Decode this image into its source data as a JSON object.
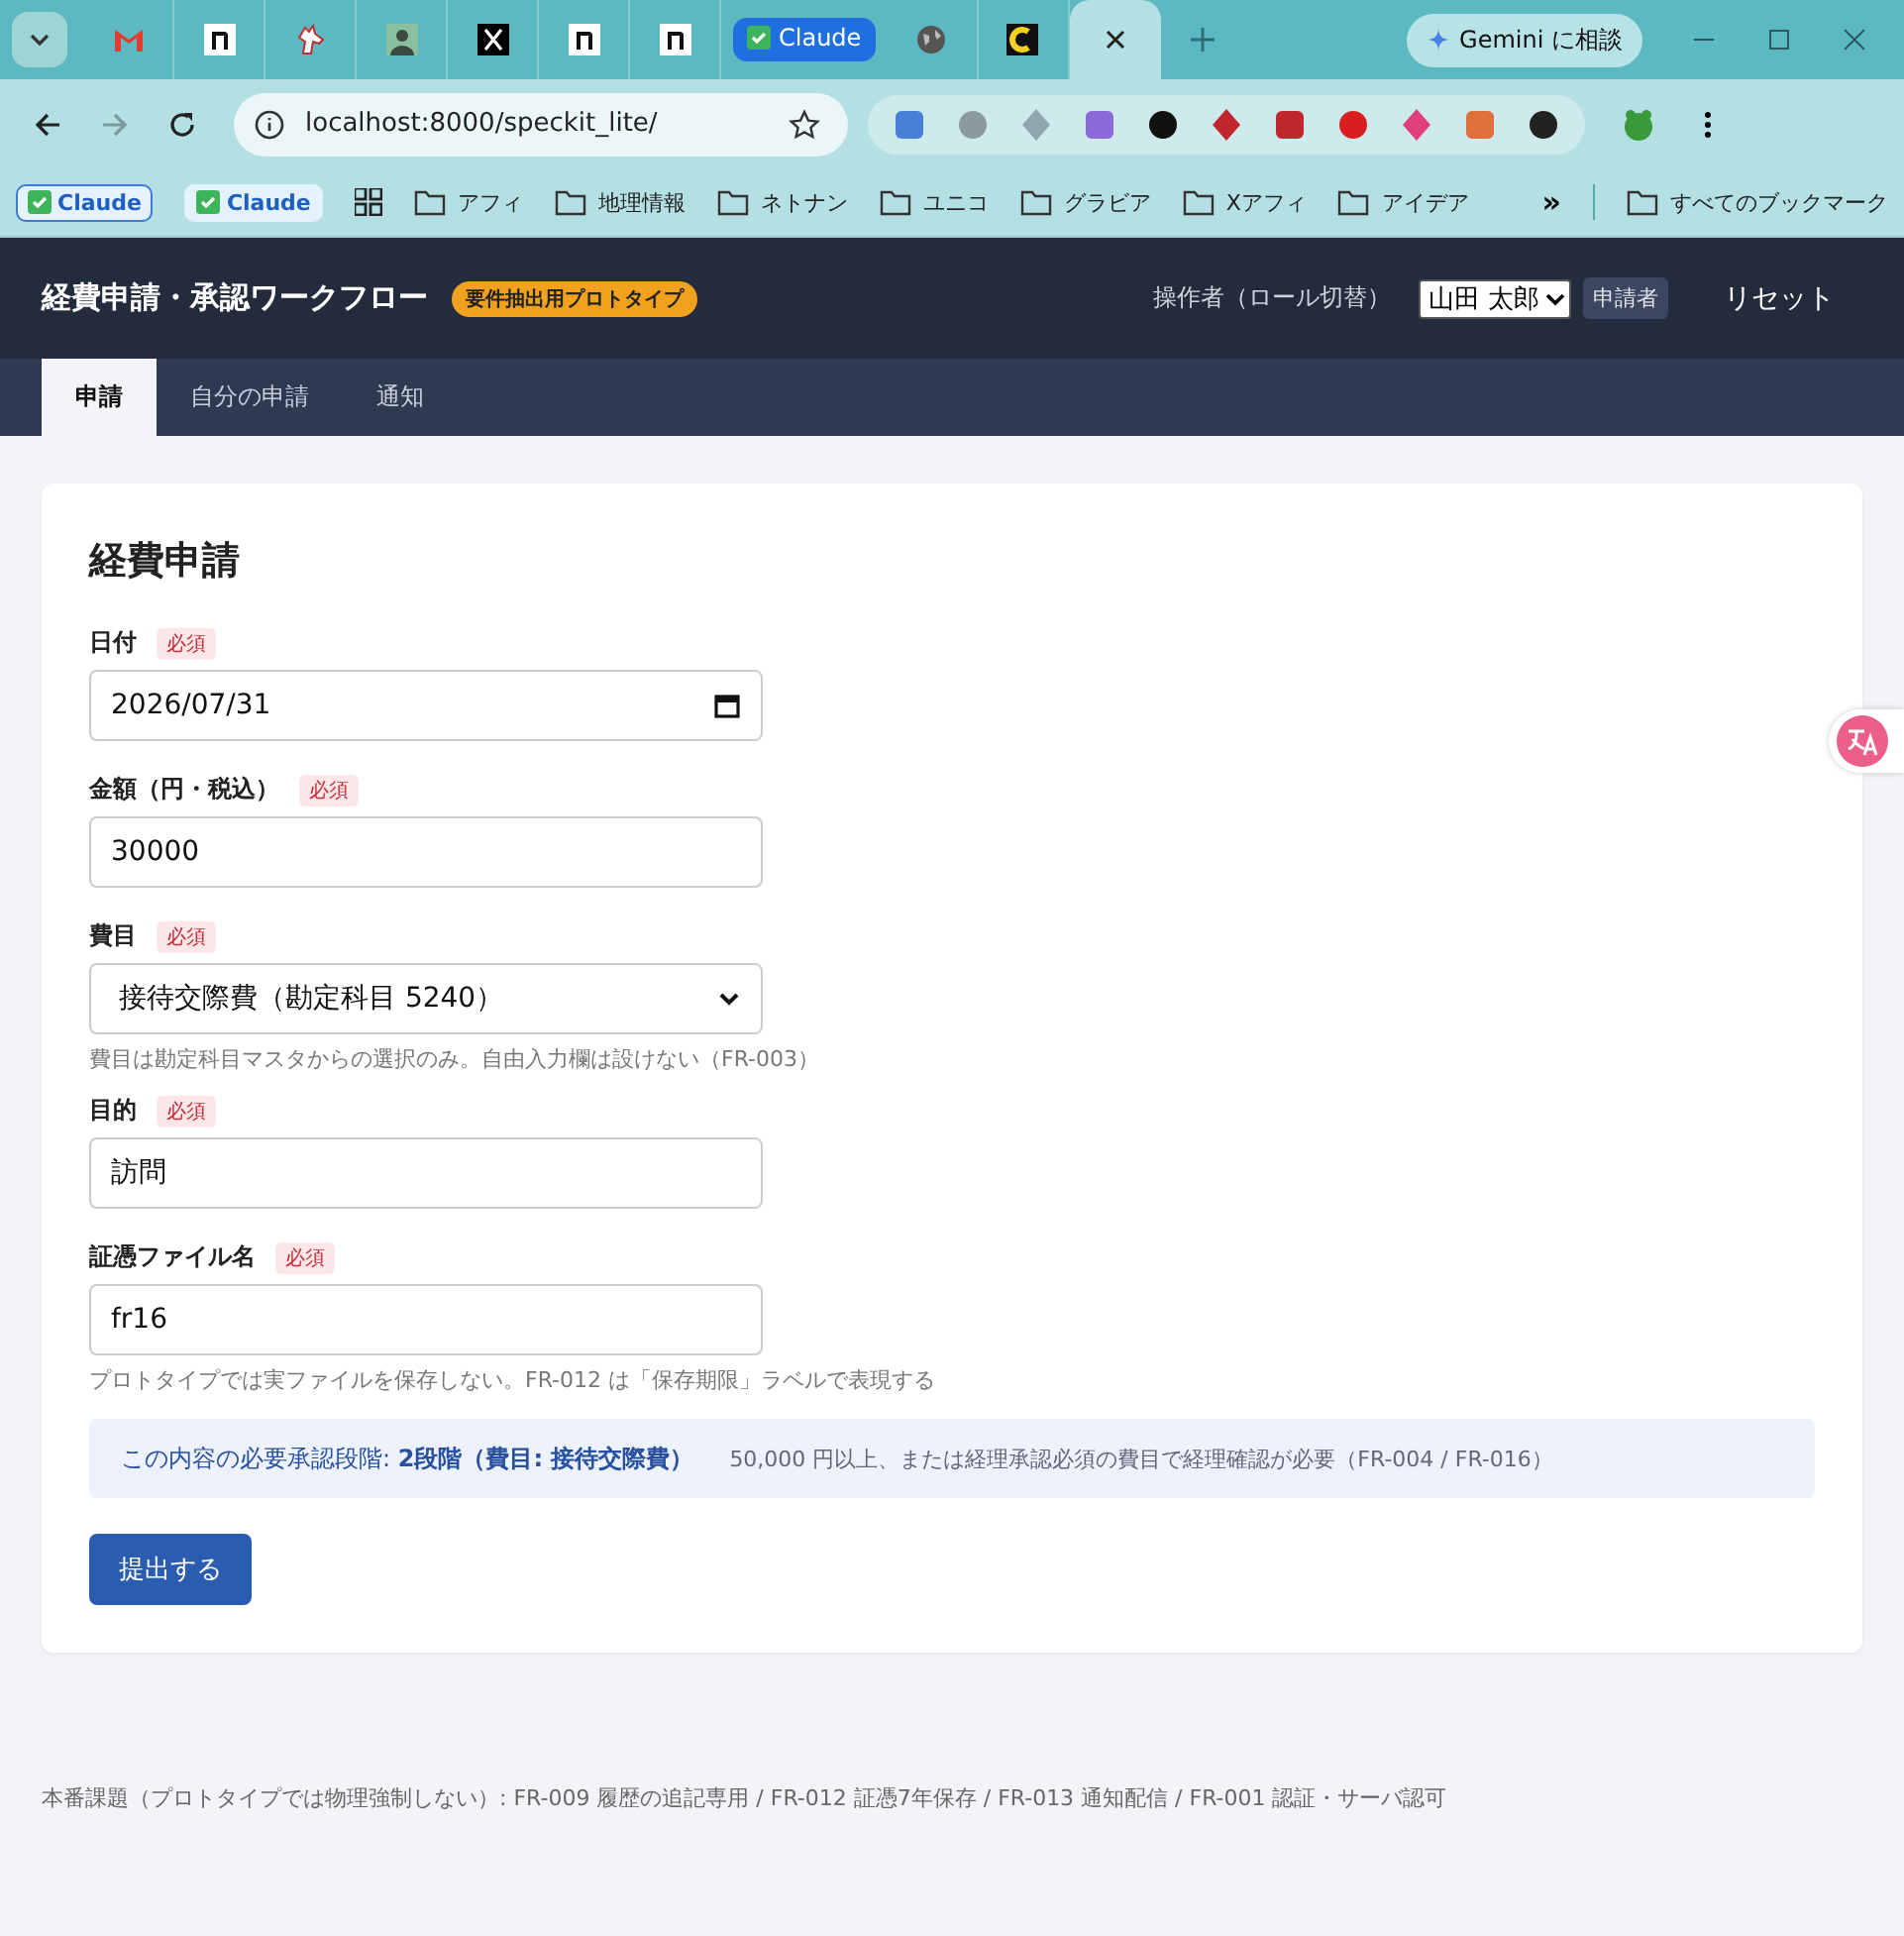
{
  "browser": {
    "tabs": [
      {
        "kind": "gmail",
        "selected": false
      },
      {
        "kind": "note",
        "selected": false
      },
      {
        "kind": "unicorn",
        "selected": false
      },
      {
        "kind": "avatar",
        "selected": false
      },
      {
        "kind": "x",
        "selected": false
      },
      {
        "kind": "note",
        "selected": false
      },
      {
        "kind": "note",
        "selected": false
      },
      {
        "kind": "group",
        "label": "Claude",
        "selected": false
      },
      {
        "kind": "globe",
        "selected": false
      },
      {
        "kind": "cursor",
        "selected": false
      },
      {
        "kind": "blank",
        "selected": true
      }
    ],
    "gemini": "Gemini に相談",
    "url": "localhost:8000/speckit_lite/",
    "extensions": [
      {
        "kind": "translate"
      },
      {
        "kind": "broom"
      },
      {
        "kind": "atom"
      },
      {
        "kind": "crystal"
      },
      {
        "kind": "flag"
      },
      {
        "kind": "pdf"
      },
      {
        "kind": "pdf"
      },
      {
        "kind": "stop"
      },
      {
        "kind": "translate-pink"
      },
      {
        "kind": "burst"
      },
      {
        "kind": "puzzle"
      }
    ],
    "bookmarks": [
      {
        "kind": "claude",
        "label": "Claude",
        "focused": true
      },
      {
        "kind": "claude",
        "label": "Claude",
        "focused": false
      },
      {
        "kind": "apps"
      },
      {
        "kind": "folder",
        "label": "アフィ"
      },
      {
        "kind": "folder",
        "label": "地理情報"
      },
      {
        "kind": "folder",
        "label": "ネトナン"
      },
      {
        "kind": "folder",
        "label": "ユニコ"
      },
      {
        "kind": "folder",
        "label": "グラビア"
      },
      {
        "kind": "folder",
        "label": "Xアフィ"
      },
      {
        "kind": "folder",
        "label": "アイデア"
      }
    ],
    "more": "»",
    "all_bookmarks": "すべてのブックマーク"
  },
  "app": {
    "title": "経費申請・承認ワークフロー",
    "badge": "要件抽出用プロトタイプ",
    "operator_label": "操作者（ロール切替）",
    "operator": "山田 太郎",
    "role": "申請者",
    "reset": "リセット",
    "tabs": [
      {
        "label": "申請",
        "selected": true
      },
      {
        "label": "自分の申請",
        "selected": false
      },
      {
        "label": "通知",
        "selected": false
      }
    ]
  },
  "form": {
    "title": "経費申請",
    "fields": [
      {
        "kind": "date",
        "label": "日付",
        "required": "必須",
        "value": "2026/07/31"
      },
      {
        "kind": "text",
        "label": "金額（円・税込）",
        "required": "必須",
        "value": "30000"
      },
      {
        "kind": "select",
        "label": "費目",
        "required": "必須",
        "value": "接待交際費（勘定科目 5240）",
        "hint": "費目は勘定科目マスタからの選択のみ。自由入力欄は設けない（FR-003）"
      },
      {
        "kind": "text",
        "label": "目的",
        "required": "必須",
        "value": "訪問"
      },
      {
        "kind": "text",
        "label": "証憑ファイル名",
        "required": "必須",
        "value": "fr16",
        "hint": "プロトタイプでは実ファイルを保存しない。FR-012 は「保存期限」ラベルで表現する"
      }
    ],
    "notice": "この内容の必要承認段階: **2段階（費目: 接待交際費）**",
    "notice_note": "50,000 円以上、または経理承認必須の費目で経理確認が必要（FR-004 / FR-016）",
    "submit": "提出する"
  },
  "footer": "本番課題（プロトタイプでは物理強制しない）: FR-009 履歴の追記専用 / FR-012 証憑7年保存 / FR-013 通知配信 / FR-001 認証・サーバ認可"
}
